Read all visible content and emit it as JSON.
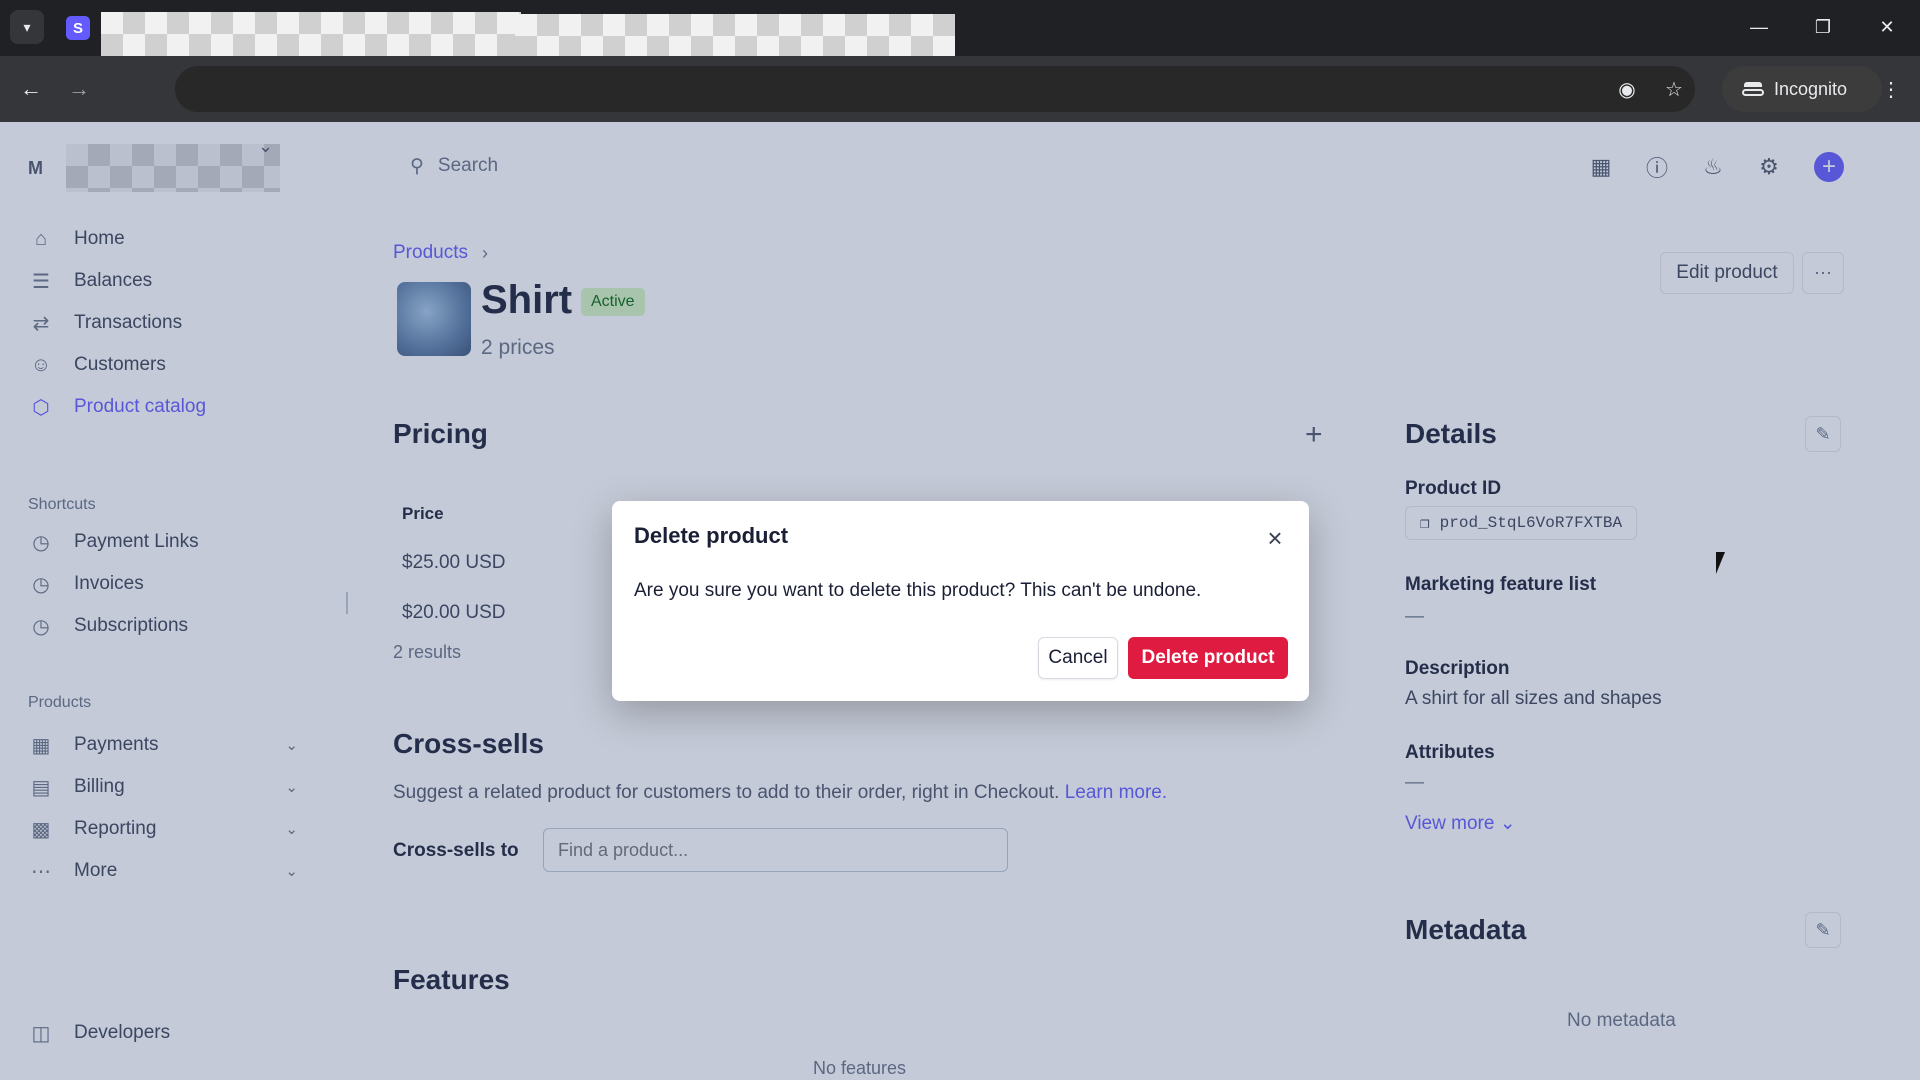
{
  "browser": {
    "tab_favicon_letter": "S",
    "incognito_label": "Incognito"
  },
  "sidebar": {
    "account_initial": "M",
    "nav": [
      {
        "label": "Home",
        "icon": "home-icon"
      },
      {
        "label": "Balances",
        "icon": "balances-icon"
      },
      {
        "label": "Transactions",
        "icon": "transactions-icon"
      },
      {
        "label": "Customers",
        "icon": "customers-icon"
      },
      {
        "label": "Product catalog",
        "icon": "product-catalog-icon",
        "active": true
      }
    ],
    "shortcuts_label": "Shortcuts",
    "shortcuts": [
      {
        "label": "Payment Links",
        "icon": "clock-icon"
      },
      {
        "label": "Invoices",
        "icon": "clock-icon"
      },
      {
        "label": "Subscriptions",
        "icon": "clock-icon"
      }
    ],
    "products_label": "Products",
    "products": [
      {
        "label": "Payments",
        "icon": "payments-icon"
      },
      {
        "label": "Billing",
        "icon": "billing-icon"
      },
      {
        "label": "Reporting",
        "icon": "reporting-icon"
      },
      {
        "label": "More",
        "icon": "more-dots-icon"
      }
    ],
    "developers": {
      "label": "Developers",
      "icon": "terminal-icon"
    }
  },
  "topbar": {
    "search_placeholder": "Search"
  },
  "main": {
    "breadcrumb": "Products",
    "product_name": "Shirt",
    "status": "Active",
    "prices_count": "2 prices",
    "edit_product_label": "Edit product",
    "pricing": {
      "title": "Pricing",
      "columns": [
        "Price"
      ],
      "rows": [
        "$25.00 USD",
        "$20.00 USD"
      ],
      "results": "2 results"
    },
    "cross_sells": {
      "title": "Cross-sells",
      "description": "Suggest a related product for customers to add to their order, right in Checkout.",
      "learn_more": "Learn more.",
      "field_label": "Cross-sells to",
      "placeholder": "Find a product..."
    },
    "features": {
      "title": "Features",
      "empty": "No features"
    }
  },
  "details": {
    "title": "Details",
    "product_id_label": "Product ID",
    "product_id": "prod_StqL6VoR7FXTBA",
    "marketing_label": "Marketing feature list",
    "marketing_value": "—",
    "description_label": "Description",
    "description_value": "A shirt for all sizes and shapes",
    "attributes_label": "Attributes",
    "attributes_value": "—",
    "view_more": "View more",
    "metadata_title": "Metadata",
    "metadata_empty": "No metadata"
  },
  "modal": {
    "title": "Delete product",
    "body": "Are you sure you want to delete this product? This can't be undone.",
    "cancel_label": "Cancel",
    "delete_label": "Delete product"
  },
  "colors": {
    "accent": "#635bff",
    "danger": "#df1b41",
    "active_badge_bg": "#d7f7c2",
    "active_badge_text": "#05690d"
  }
}
